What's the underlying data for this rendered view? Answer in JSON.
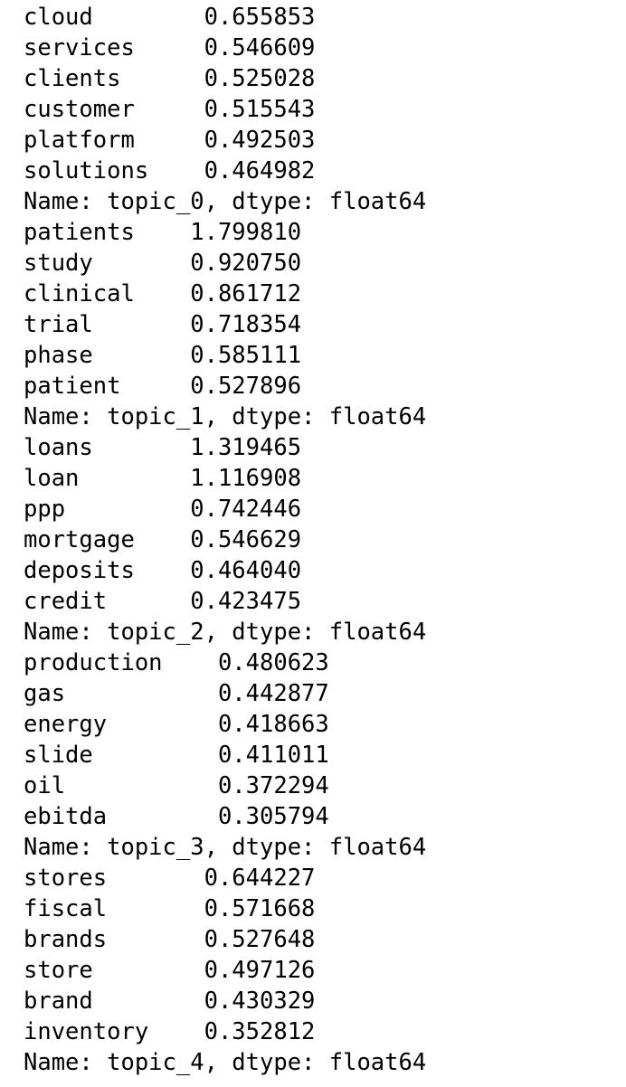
{
  "blocks": [
    {
      "rows": [
        {
          "term": "cloud",
          "value": "0.655853"
        },
        {
          "term": "services",
          "value": "0.546609"
        },
        {
          "term": "clients",
          "value": "0.525028"
        },
        {
          "term": "customer",
          "value": "0.515543"
        },
        {
          "term": "platform",
          "value": "0.492503"
        },
        {
          "term": "solutions",
          "value": "0.464982"
        }
      ],
      "footer": "Name: topic_0, dtype: float64"
    },
    {
      "rows": [
        {
          "term": "patients",
          "value": "1.799810"
        },
        {
          "term": "study",
          "value": "0.920750"
        },
        {
          "term": "clinical",
          "value": "0.861712"
        },
        {
          "term": "trial",
          "value": "0.718354"
        },
        {
          "term": "phase",
          "value": "0.585111"
        },
        {
          "term": "patient",
          "value": "0.527896"
        }
      ],
      "footer": "Name: topic_1, dtype: float64"
    },
    {
      "rows": [
        {
          "term": "loans",
          "value": "1.319465"
        },
        {
          "term": "loan",
          "value": "1.116908"
        },
        {
          "term": "ppp",
          "value": "0.742446"
        },
        {
          "term": "mortgage",
          "value": "0.546629"
        },
        {
          "term": "deposits",
          "value": "0.464040"
        },
        {
          "term": "credit",
          "value": "0.423475"
        }
      ],
      "footer": "Name: topic_2, dtype: float64"
    },
    {
      "rows": [
        {
          "term": "production",
          "value": "0.480623"
        },
        {
          "term": "gas",
          "value": "0.442877"
        },
        {
          "term": "energy",
          "value": "0.418663"
        },
        {
          "term": "slide",
          "value": "0.411011"
        },
        {
          "term": "oil",
          "value": "0.372294"
        },
        {
          "term": "ebitda",
          "value": "0.305794"
        }
      ],
      "footer": "Name: topic_3, dtype: float64"
    },
    {
      "rows": [
        {
          "term": "stores",
          "value": "0.644227"
        },
        {
          "term": "fiscal",
          "value": "0.571668"
        },
        {
          "term": "brands",
          "value": "0.527648"
        },
        {
          "term": "store",
          "value": "0.497126"
        },
        {
          "term": "brand",
          "value": "0.430329"
        },
        {
          "term": "inventory",
          "value": "0.352812"
        }
      ],
      "footer": "Name: topic_4, dtype: float64"
    }
  ]
}
